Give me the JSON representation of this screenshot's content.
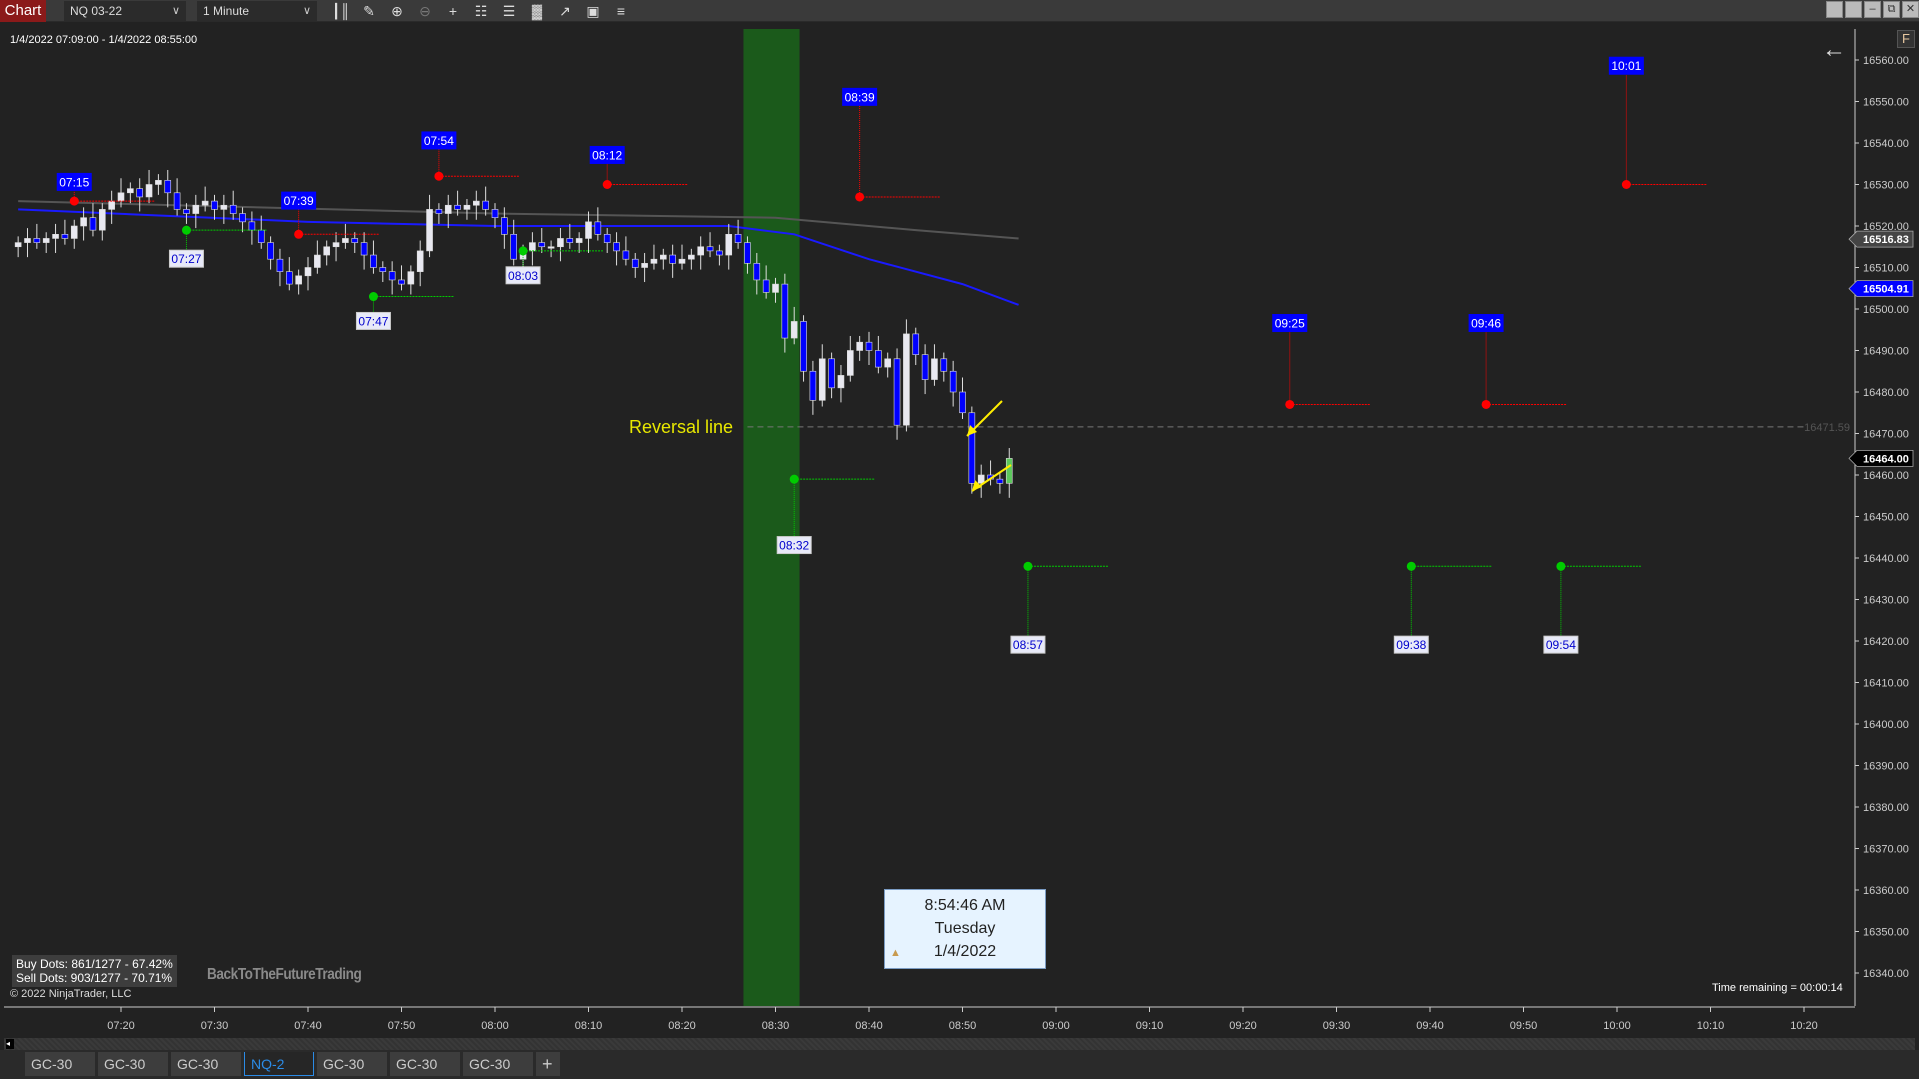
{
  "toolbar": {
    "chart_label": "Chart",
    "instrument": "NQ 03-22",
    "interval": "1 Minute",
    "icons": [
      "bar-type-icon",
      "drawing-tool-icon",
      "zoom-in-icon",
      "zoom-out-icon",
      "crosshair-icon",
      "data-box-icon",
      "chart-trader-icon",
      "strategies-icon",
      "indicators-icon",
      "properties-icon",
      "templates-icon"
    ]
  },
  "range_text": "1/4/2022 07:09:00 - 1/4/2022 08:55:00",
  "stats": {
    "buy": "Buy Dots: 861/1277 - 67.42%",
    "sell": "Sell Dots: 903/1277 - 70.71%"
  },
  "watermark": "BackToTheFutureTrading",
  "copyright": "© 2022 NinjaTrader, LLC",
  "time_remaining": "Time remaining = 00:00:14",
  "tooltip": {
    "time": "8:54:46 AM",
    "day": "Tuesday",
    "date": "1/4/2022"
  },
  "reversal_label": "Reversal line",
  "f_label": "F",
  "colors": {
    "up": "#e8e8f0",
    "down": "#0000ff",
    "last": "#5cc85c",
    "buy_dot": "#00cc00",
    "sell_dot": "#ff0000",
    "zone": "#1b5a1b",
    "ma": "#1a1aff",
    "slow_ma": "#555555",
    "reversal": "#777777"
  },
  "price_axis": {
    "min": 16340,
    "max": 16560,
    "step": 10,
    "tags": [
      {
        "value": "16516.83",
        "bg": "#444444",
        "fg": "#ffffff"
      },
      {
        "value": "16504.91",
        "bg": "#0000ff",
        "fg": "#ffffff"
      },
      {
        "value": "16464.00",
        "bg": "#000000",
        "fg": "#ffffff"
      }
    ],
    "reversal_value": "16471.59"
  },
  "time_axis": {
    "labels": [
      "07:20",
      "07:30",
      "07:40",
      "07:50",
      "08:00",
      "08:10",
      "08:20",
      "08:30",
      "08:40",
      "08:50",
      "09:00",
      "09:10",
      "09:20",
      "09:30",
      "09:40",
      "09:50",
      "10:00",
      "10:10",
      "10:20"
    ]
  },
  "bars": {
    "start": "07:09",
    "closes": [
      16516,
      16517,
      16516,
      16517,
      16518,
      16517,
      16520,
      16522,
      16519,
      16524,
      16526,
      16528,
      16529,
      16527,
      16530,
      16531,
      16528,
      16524,
      16523,
      16525,
      16526,
      16524,
      16525,
      16523,
      16521,
      16519,
      16516,
      16512,
      16509,
      16506,
      16508,
      16510,
      16513,
      16515,
      16516,
      16517,
      16516,
      16513,
      16510,
      16509,
      16507,
      16506,
      16509,
      16514,
      16524,
      16523,
      16525,
      16524,
      16525,
      16526,
      16524,
      16522,
      16518,
      16512,
      16514,
      16516,
      16515,
      16515,
      16517,
      16516,
      16517,
      16521,
      16518,
      16516,
      16514,
      16512,
      16510,
      16511,
      16512,
      16513,
      16511,
      16512,
      16513,
      16515,
      16514,
      16513,
      16518,
      16516,
      16511,
      16507,
      16504,
      16506,
      16493,
      16497,
      16485,
      16478,
      16488,
      16481,
      16484,
      16490,
      16492,
      16490,
      16486,
      16488,
      16472,
      16494,
      16489,
      16483,
      16488,
      16485,
      16480,
      16475,
      16458,
      16460,
      16459,
      16458,
      16464
    ]
  },
  "zone": {
    "from": "08:27",
    "to": "08:33"
  },
  "ma_fast": [
    [
      "07:09",
      16524
    ],
    [
      "07:40",
      16521
    ],
    [
      "08:00",
      16520
    ],
    [
      "08:25",
      16520
    ],
    [
      "08:32",
      16518
    ],
    [
      "08:40",
      16512
    ],
    [
      "08:50",
      16506
    ],
    [
      "08:56",
      16501
    ]
  ],
  "ma_slow": [
    [
      "07:09",
      16526
    ],
    [
      "08:00",
      16523
    ],
    [
      "08:30",
      16522
    ],
    [
      "08:45",
      16519
    ],
    [
      "08:56",
      16517
    ]
  ],
  "reversal": {
    "price": 16471.59,
    "from": "08:27"
  },
  "signals": [
    {
      "type": "sell",
      "time": "07:15",
      "price": 16526,
      "label_price": 16530.5
    },
    {
      "type": "sell",
      "time": "07:39",
      "price": 16518,
      "label_price": 16526
    },
    {
      "type": "sell",
      "time": "07:54",
      "price": 16532,
      "label_price": 16540.5
    },
    {
      "type": "sell",
      "time": "08:12",
      "price": 16530,
      "label_price": 16537
    },
    {
      "type": "sell",
      "time": "08:39",
      "price": 16527,
      "label_price": 16551
    },
    {
      "type": "sell",
      "time": "09:25",
      "price": 16477,
      "label_price": 16496.5
    },
    {
      "type": "sell",
      "time": "09:46",
      "price": 16477,
      "label_price": 16496.5
    },
    {
      "type": "sell",
      "time": "10:01",
      "price": 16530,
      "label_price": 16558.5
    },
    {
      "type": "buy",
      "time": "07:27",
      "price": 16519,
      "label_price": 16512
    },
    {
      "type": "buy",
      "time": "07:47",
      "price": 16503,
      "label_price": 16497
    },
    {
      "type": "buy",
      "time": "08:03",
      "price": 16514,
      "label_price": 16508
    },
    {
      "type": "buy",
      "time": "08:32",
      "price": 16459,
      "label_price": 16443
    },
    {
      "type": "buy",
      "time": "08:57",
      "price": 16438,
      "label_price": 16419
    },
    {
      "type": "buy",
      "time": "09:38",
      "price": 16438,
      "label_price": 16419
    },
    {
      "type": "buy",
      "time": "09:54",
      "price": 16438,
      "label_price": 16419
    }
  ],
  "tabs": [
    {
      "label": "GC-30"
    },
    {
      "label": "GC-30"
    },
    {
      "label": "GC-30"
    },
    {
      "label": "NQ-2",
      "active": true
    },
    {
      "label": "GC-30"
    },
    {
      "label": "GC-30"
    },
    {
      "label": "GC-30"
    }
  ],
  "add_tab": "+"
}
